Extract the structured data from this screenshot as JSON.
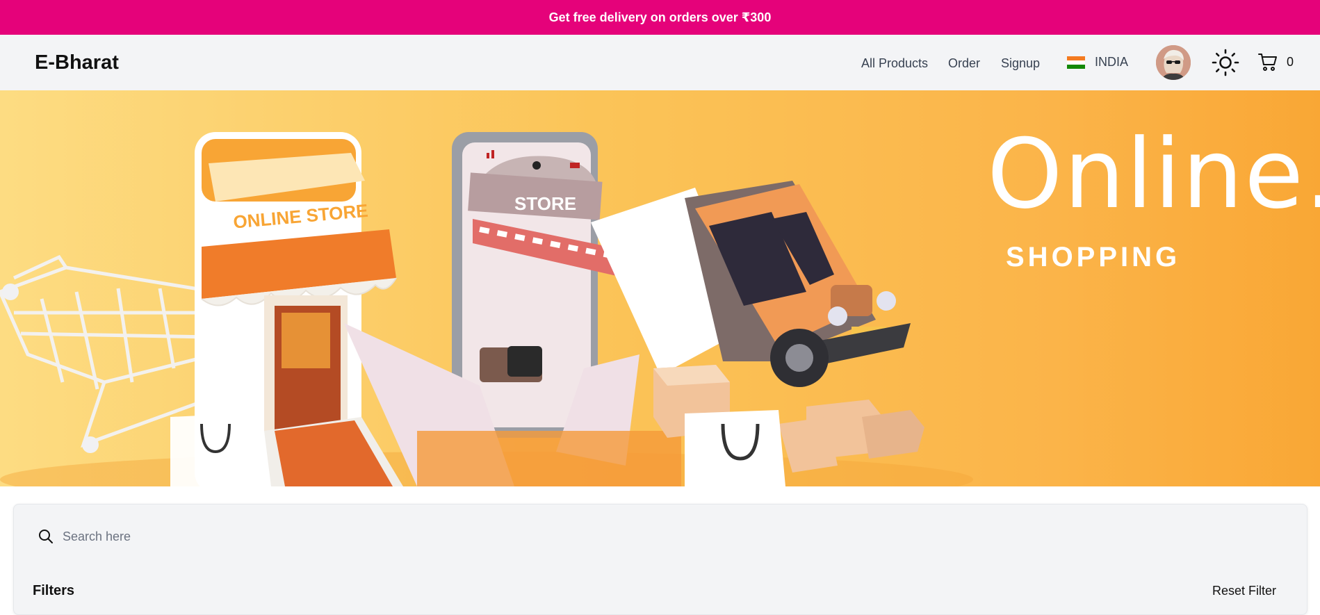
{
  "promo": {
    "text": "Get free delivery on orders over ₹300"
  },
  "nav": {
    "brand": "E-Bharat",
    "links": [
      "All Products",
      "Order",
      "Signup"
    ],
    "country": "INDIA",
    "cart_count": "0",
    "icons": {
      "theme": "sun-icon",
      "cart": "cart-icon"
    }
  },
  "hero": {
    "title": "Online.",
    "subtitle": "SHOPPING",
    "store_sign": "ONLINE STORE",
    "phone_sign": "STORE"
  },
  "filters": {
    "search_placeholder": "Search here",
    "title": "Filters",
    "reset_label": "Reset Filter"
  },
  "colors": {
    "promo": "#e5027a",
    "nav_bg": "#f3f4f6",
    "hero_orange": "#fbb449"
  }
}
